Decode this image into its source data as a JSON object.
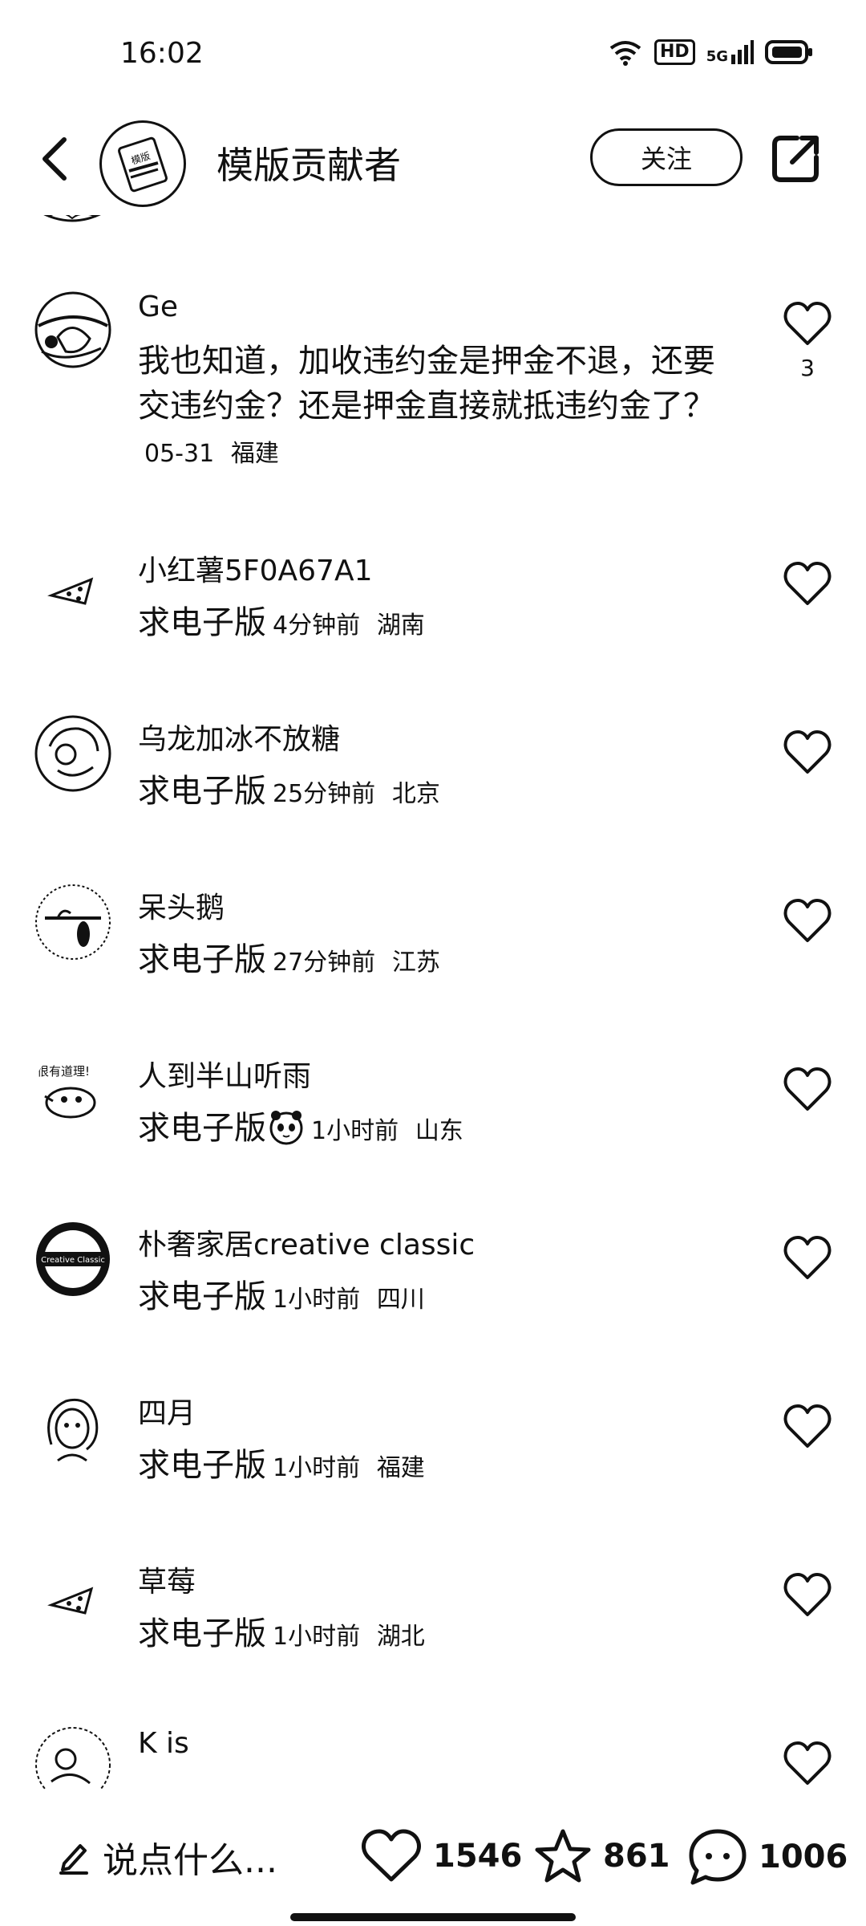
{
  "status": {
    "time": "16:02",
    "hd": "HD",
    "network": "5G"
  },
  "header": {
    "title": "模版贡献者",
    "follow_label": "关注"
  },
  "comments": [
    {
      "name": "Ge",
      "text": "我也知道，加收违约金是押金不退，还要交违约金？还是押金直接就抵违约金了？",
      "time": "05-31",
      "location": "福建",
      "likes": "3"
    },
    {
      "name": "小红薯5F0A67A1",
      "text": "求电子版",
      "time": "4分钟前",
      "location": "湖南"
    },
    {
      "name": "乌龙加冰不放糖",
      "text": "求电子版",
      "time": "25分钟前",
      "location": "北京"
    },
    {
      "name": "呆头鹅",
      "text": "求电子版",
      "time": "27分钟前",
      "location": "江苏"
    },
    {
      "name": "人到半山听雨",
      "text": "求电子版",
      "time": "1小时前",
      "location": "山东"
    },
    {
      "name": "朴奢家居creative classic",
      "text": "求电子版",
      "time": "1小时前",
      "location": "四川"
    },
    {
      "name": "四月",
      "text": "求电子版",
      "time": "1小时前",
      "location": "福建"
    },
    {
      "name": "草莓",
      "text": "求电子版",
      "time": "1小时前",
      "location": "湖北"
    },
    {
      "name": "K is"
    }
  ],
  "bottom": {
    "placeholder": "说点什么...",
    "likes": "1546",
    "stars": "861",
    "comments": "1006"
  },
  "avatar_texts": {
    "header_logo": "模版",
    "creative_logo": "Creative Classic",
    "reason_sticker": "很有道理!"
  }
}
